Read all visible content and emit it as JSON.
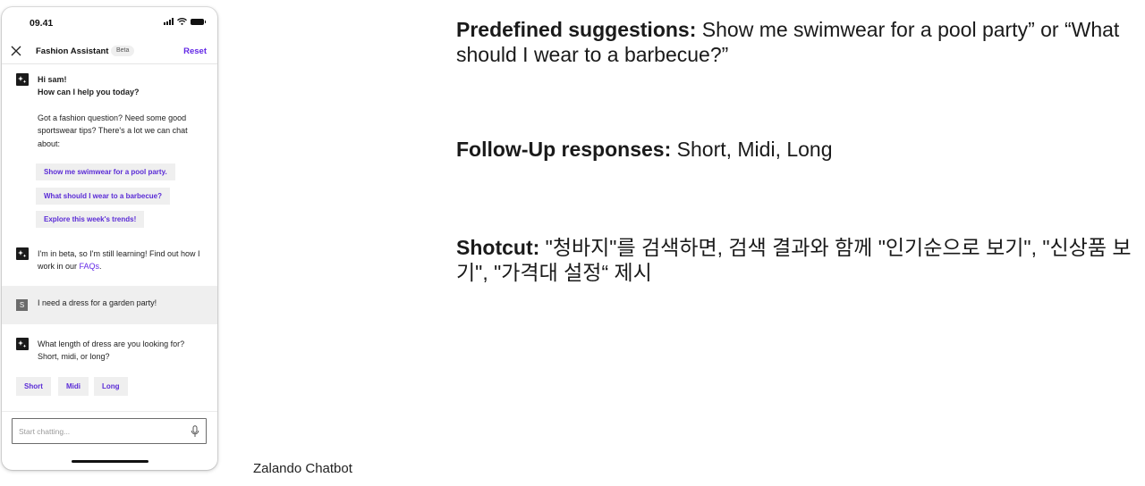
{
  "phone": {
    "status_time": "09.41",
    "header": {
      "title": "Fashion Assistant",
      "badge": "Beta",
      "reset_label": "Reset"
    },
    "greeting": {
      "line1": "Hi sam!",
      "line2": "How can I help you today?",
      "body": "Got a fashion question? Need some good sportswear tips? There's a lot we can chat about:"
    },
    "suggestions": [
      "Show me swimwear for a pool party.",
      "What should I wear to a barbecue?",
      "Explore this week's trends!"
    ],
    "beta_note": {
      "text": "I'm in beta, so I'm still learning! Find out how I work in our ",
      "link": "FAQs",
      "end": "."
    },
    "user_message": {
      "avatar_letter": "S",
      "text": "I need a dress for a garden party!"
    },
    "bot_question": "What length of dress are you looking for? Short, midi, or long?",
    "follow_ups": [
      "Short",
      "Midi",
      "Long"
    ],
    "input_placeholder": "Start chatting..."
  },
  "caption": "Zalando Chatbot",
  "notes": [
    {
      "label": "Predefined suggestions:",
      "text": " Show me swimwear for a pool party” or “What should I wear to a barbecue?”"
    },
    {
      "label": "Follow-Up responses:",
      "text": " Short, Midi, Long"
    },
    {
      "label": "Shotcut:",
      "text": " \"청바지\"를 검색하면, 검색 결과와 함께 \"인기순으로 보기\", \"신상품 보기\", \"가격대 설정“ 제시"
    }
  ],
  "colors": {
    "accent": "#6328e6",
    "chip_bg": "#efefef",
    "user_row_bg": "#efefef"
  },
  "icons": [
    "close-icon",
    "bot-sparkle-icon",
    "mic-icon",
    "signal-icon",
    "wifi-icon",
    "battery-icon"
  ]
}
